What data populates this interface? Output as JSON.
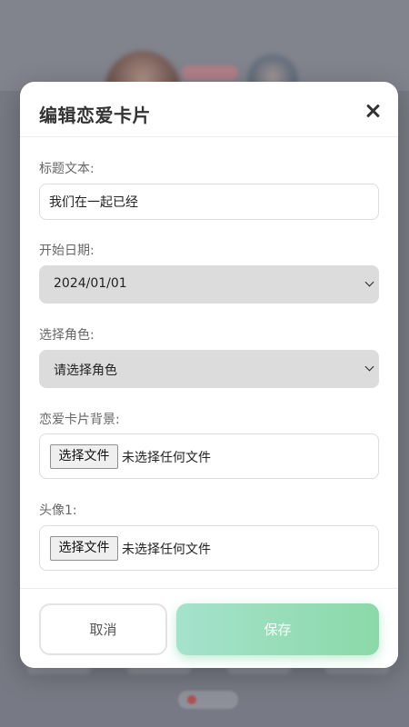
{
  "modal": {
    "title": "编辑恋爱卡片"
  },
  "form": {
    "title_text": {
      "label": "标题文本:",
      "value": "我们在一起已经"
    },
    "start_date": {
      "label": "开始日期:",
      "value": "2024/01/01"
    },
    "role": {
      "label": "选择角色:",
      "value": "请选择角色"
    },
    "card_background": {
      "label": "恋爱卡片背景:",
      "button_label": "选择文件",
      "status": "未选择任何文件"
    },
    "avatar1": {
      "label": "头像1:",
      "button_label": "选择文件",
      "status": "未选择任何文件"
    }
  },
  "footer": {
    "cancel_label": "取消",
    "save_label": "保存"
  },
  "colors": {
    "save_gradient_start": "#a5e2cc",
    "save_gradient_end": "#8bd9a8",
    "select_bg": "#dcdcdc"
  }
}
